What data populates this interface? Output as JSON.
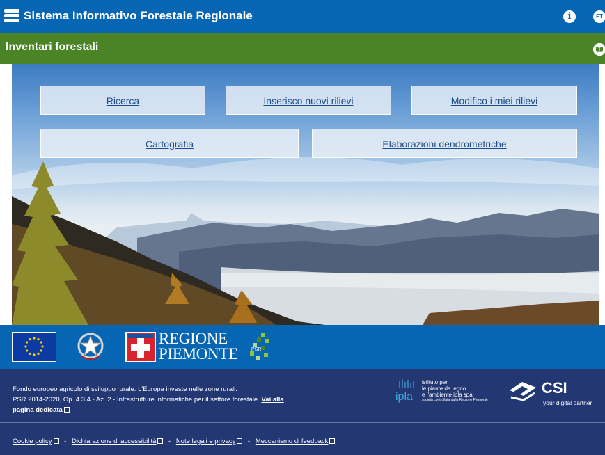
{
  "header": {
    "title": "Sistema Informativo Forestale Regionale",
    "info_glyph": "i",
    "user_initials": "FT"
  },
  "subheader": {
    "title": "Inventari forestali"
  },
  "nav_buttons": {
    "ricerca": "Ricerca",
    "inserisco": "Inserisco nuovi rilievi",
    "modifico": "Modifico i miei rilievi",
    "cartografia": "Cartografia",
    "elaborazioni": "Elaborazioni dendrometriche"
  },
  "logos": {
    "regione_line1": "REGIONE",
    "regione_line2": "PIEMONTE",
    "psr": "PSR"
  },
  "footer": {
    "line1": "Fondo europeo agricolo di sviluppo rurale. L'Europa investe nelle zone rurali.",
    "line2": "PSR 2014-2020, Op. 4.3.4 - Az. 2 - Infrastrutture informatiche per il settore forestale.",
    "link_vai": "Vai alla pagina dedicata",
    "ipla_line1": "istituto per",
    "ipla_line2": "le piante da legno",
    "ipla_line3": "e l'ambiente ipla spa",
    "ipla_line4": "società controllata dalla Regione Piemonte",
    "ipla_mark": "ipla",
    "csi_brand": "CSI",
    "csi_tag": "your digital partner",
    "links": {
      "cookie": "Cookie policy",
      "accessibilita": "Dichiarazione di accessibilità",
      "note": "Note legali e privacy",
      "feedback": "Meccanismo di feedback"
    },
    "separator": "-"
  },
  "colors": {
    "header": "#0766b3",
    "subheader": "#4a8427",
    "footer": "#233773"
  }
}
